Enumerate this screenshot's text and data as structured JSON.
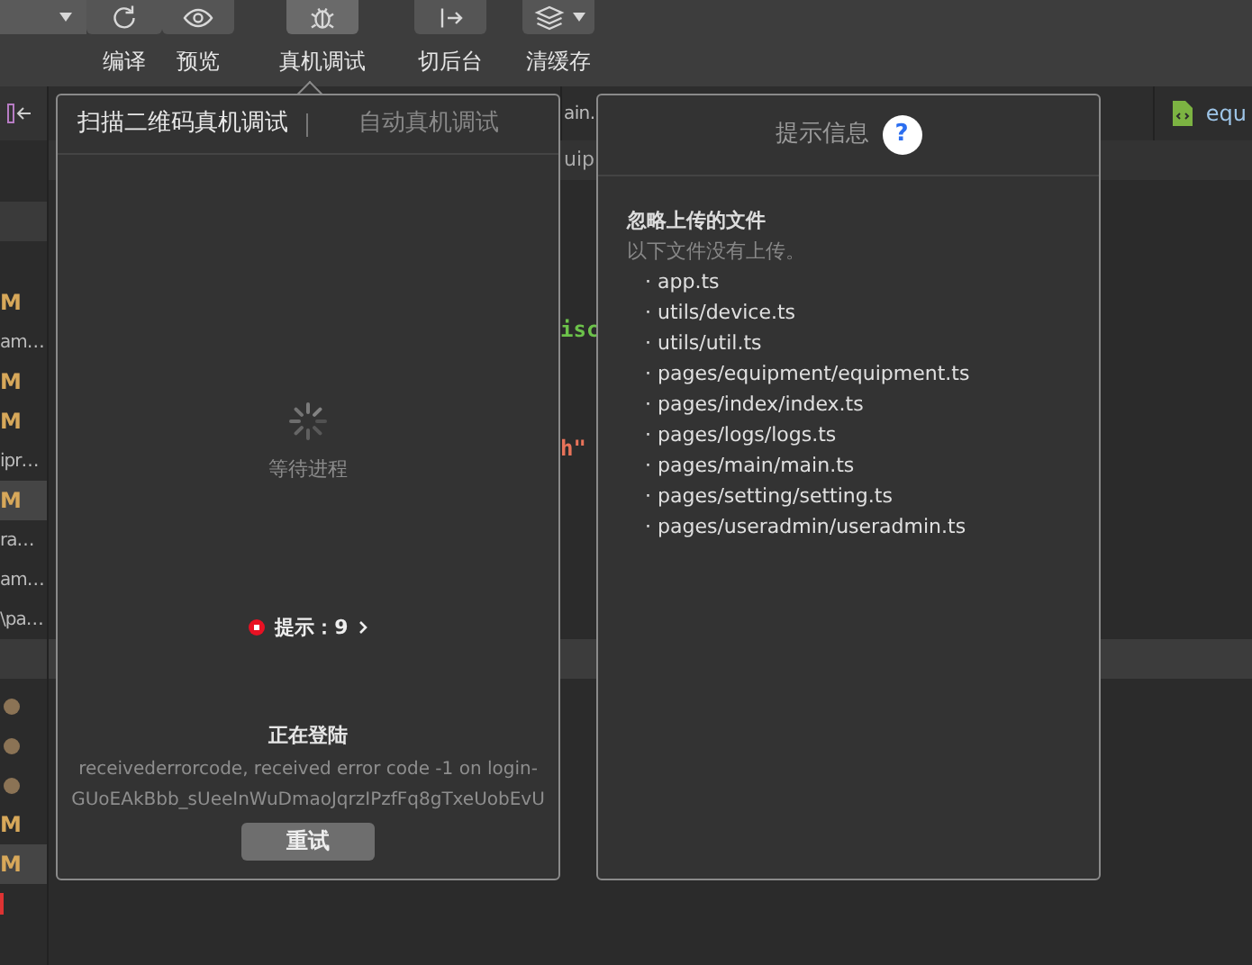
{
  "toolbar": {
    "items": [
      {
        "kind": "compile",
        "label": "编译",
        "selected": false
      },
      {
        "kind": "preview",
        "label": "预览",
        "selected": false
      },
      {
        "kind": "debug",
        "label": "真机调试",
        "selected": true
      },
      {
        "kind": "background",
        "label": "切后台",
        "selected": false
      },
      {
        "kind": "cache",
        "label": "清缓存",
        "selected": false
      }
    ]
  },
  "editor_tabs": [
    {
      "label": "ain.",
      "kind": "plain"
    },
    {
      "label": "equ",
      "kind": "file"
    }
  ],
  "breadcrumb": "uip",
  "code_fragments": [
    {
      "text": "isc",
      "color": "#6cc24a"
    },
    {
      "text": "h\"",
      "color": "#e8735a"
    }
  ],
  "sidebar": {
    "sections": [
      {
        "items": [
          {
            "kind": "text",
            "text": "M",
            "selected": false
          },
          {
            "kind": "text",
            "text": "am…",
            "selected": false
          },
          {
            "kind": "text",
            "text": "M",
            "selected": false
          },
          {
            "kind": "text",
            "text": "M",
            "selected": false
          },
          {
            "kind": "text",
            "text": "ipr…",
            "selected": false
          },
          {
            "kind": "text",
            "text": "M",
            "selected": true
          },
          {
            "kind": "text",
            "text": "ra…",
            "selected": false
          },
          {
            "kind": "text",
            "text": "am…",
            "selected": false
          },
          {
            "kind": "text",
            "text": "\\pa…",
            "selected": false
          }
        ]
      },
      {
        "items": [
          {
            "kind": "dot",
            "selected": false
          },
          {
            "kind": "dot",
            "selected": false
          },
          {
            "kind": "dot",
            "selected": false
          },
          {
            "kind": "text",
            "text": "M",
            "selected": false
          },
          {
            "kind": "text",
            "text": "M",
            "selected": true
          },
          {
            "kind": "error",
            "selected": false
          }
        ]
      }
    ]
  },
  "debug_popover": {
    "tabs": [
      {
        "label": "扫描二维码真机调试",
        "selected": true
      },
      {
        "label": "自动真机调试",
        "selected": false
      }
    ],
    "status": "等待进程",
    "hint": "提示：9",
    "login_title": "正在登陆",
    "error": "receivederrorcode, received error code -1 on login-GUoEAkBbb_sUeeInWuDmaoJqrzIPzfFq8gTxeUobEvU",
    "retry_button": "重试"
  },
  "info_popover": {
    "title": "提示信息",
    "help": "?",
    "section_title": "忽略上传的文件",
    "section_note": "以下文件没有上传。",
    "files": [
      "· app.ts",
      "· utils/device.ts",
      "· utils/util.ts",
      "· pages/equipment/equipment.ts",
      "· pages/index/index.ts",
      "· pages/logs/logs.ts",
      "· pages/main/main.ts",
      "· pages/setting/setting.ts",
      "· pages/useradmin/useradmin.ts"
    ]
  }
}
